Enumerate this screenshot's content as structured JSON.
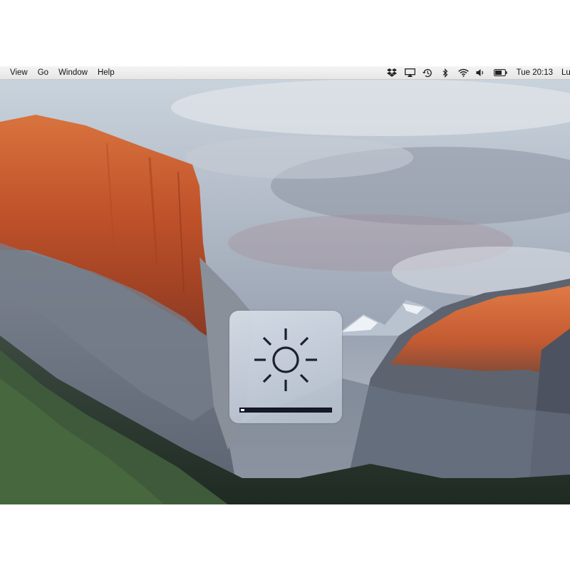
{
  "menubar": {
    "menus": [
      "View",
      "Go",
      "Window",
      "Help"
    ],
    "status_icons": [
      "dropbox-icon",
      "airplay-icon",
      "time-machine-icon",
      "bluetooth-icon",
      "wifi-icon",
      "volume-icon",
      "battery-icon"
    ],
    "clock": "Tue 20:13",
    "user": "Lu"
  },
  "brightness_hud": {
    "icon": "brightness-sun-icon",
    "level": 0.04
  },
  "colors": {
    "hud_bar": "#161a2a",
    "hud_fill": "#ffffff"
  }
}
